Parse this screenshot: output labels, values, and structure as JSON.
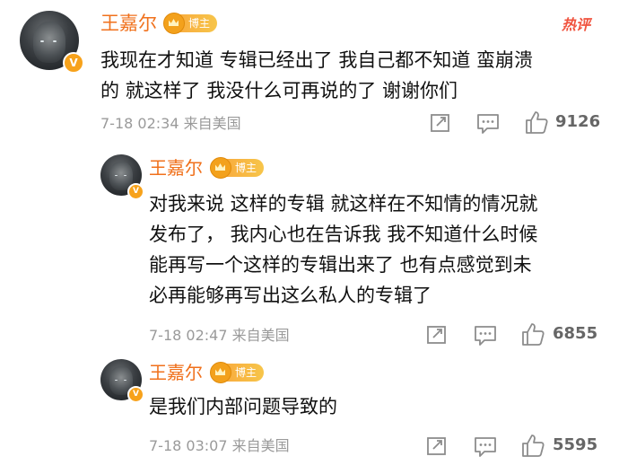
{
  "hot_tag": "热评",
  "watermark": "",
  "comments": [
    {
      "author": "王嘉尔",
      "badge_label": "博主",
      "verified_mark": "V",
      "lines": [
        "我现在才知道 专辑已经出了 我自己都不知道 蛮崩溃",
        "的  就这样了 我没什么可再说的了  谢谢你们"
      ],
      "meta": "7-18 02:34  来自美国",
      "likes": "9126",
      "icons": [
        "share-icon",
        "comment-icon",
        "like-icon"
      ]
    },
    {
      "author": "王嘉尔",
      "badge_label": "博主",
      "verified_mark": "V",
      "lines": [
        "对我来说 这样的专辑 就这样在不知情的情况就",
        "发布了，  我内心也在告诉我 我不知道什么时候",
        "能再写一个这样的专辑出来了 也有点感觉到未",
        "必再能够再写出这么私人的专辑了"
      ],
      "meta": "7-18 02:47  来自美国",
      "likes": "6855",
      "icons": [
        "share-icon",
        "comment-icon",
        "like-icon"
      ]
    },
    {
      "author": "王嘉尔",
      "badge_label": "博主",
      "verified_mark": "V",
      "lines": [
        "是我们内部问题导致的"
      ],
      "meta": "7-18 03:07  来自美国",
      "likes": "5595",
      "icons": [
        "share-icon",
        "comment-icon",
        "like-icon"
      ]
    }
  ]
}
